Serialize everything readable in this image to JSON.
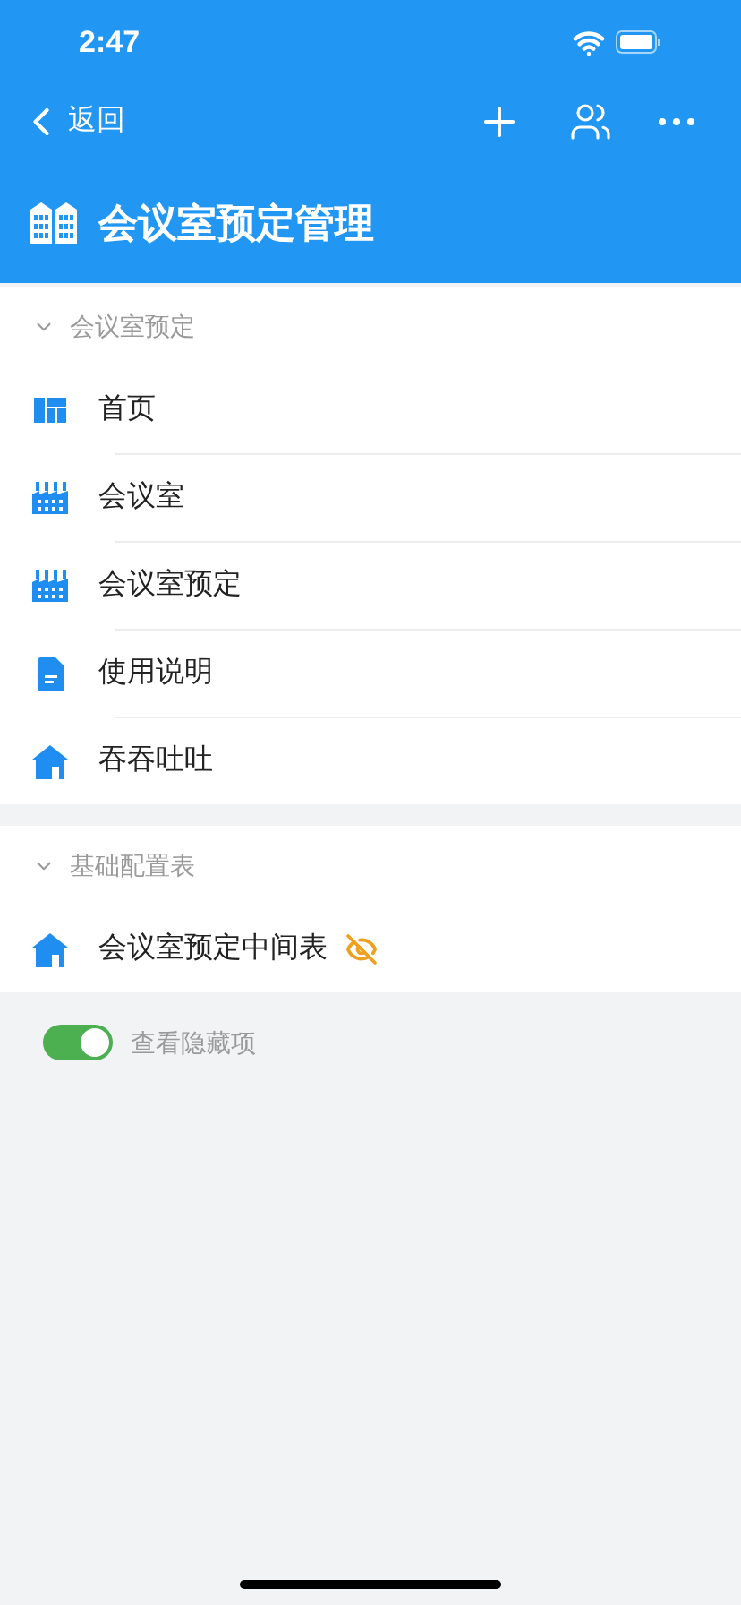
{
  "status_bar": {
    "time": "2:47"
  },
  "nav_bar": {
    "back_label": "返回"
  },
  "title": "会议室预定管理",
  "sections": [
    {
      "title": "会议室预定",
      "expanded": true,
      "items": [
        {
          "label": "首页",
          "kind": "dashboard",
          "hidden": false
        },
        {
          "label": "会议室",
          "kind": "factory",
          "hidden": false
        },
        {
          "label": "会议室预定",
          "kind": "factory",
          "hidden": false
        },
        {
          "label": "使用说明",
          "kind": "document",
          "hidden": false
        },
        {
          "label": "吞吞吐吐",
          "kind": "house",
          "hidden": false
        }
      ]
    },
    {
      "title": "基础配置表",
      "expanded": true,
      "items": [
        {
          "label": "会议室预定中间表",
          "kind": "house",
          "hidden": true
        }
      ]
    }
  ],
  "show_hidden": {
    "label": "查看隐藏项",
    "on": true
  }
}
